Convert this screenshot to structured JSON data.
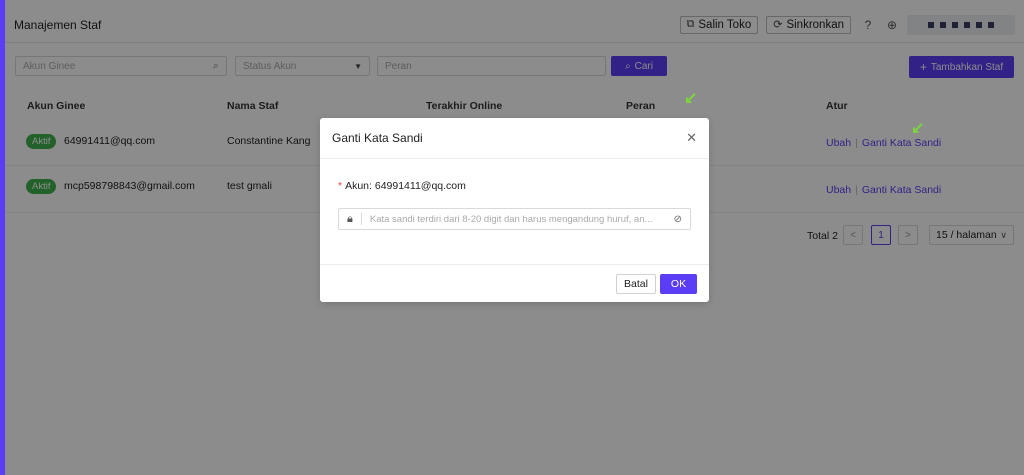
{
  "header": {
    "title": "Manajemen Staf",
    "copy_store_label": "Salin Toko",
    "sync_label": "Sinkronkan"
  },
  "filters": {
    "account_placeholder": "Akun Ginee",
    "status_placeholder": "Status Akun",
    "role_placeholder": "Peran",
    "search_label": "Cari",
    "add_staff_label": "Tambahkan Staf"
  },
  "table": {
    "columns": [
      "Akun Ginee",
      "Nama Staf",
      "Terakhir Online",
      "Peran",
      "Atur"
    ],
    "rows": [
      {
        "status": "Aktif",
        "account": "64991411@qq.com",
        "name": "Constantine Kang",
        "edit": "Ubah",
        "change_password": "Ganti Kata Sandi"
      },
      {
        "status": "Aktif",
        "account": "mcp598798843@gmail.com",
        "name": "test gmali",
        "edit": "Ubah",
        "change_password": "Ganti Kata Sandi"
      }
    ]
  },
  "pagination": {
    "total": "Total 2",
    "prev": "<",
    "current": "1",
    "next": ">",
    "page_size": "15 / halaman"
  },
  "modal": {
    "title": "Ganti Kata Sandi",
    "required_mark": "*",
    "account_label": "Akun: 64991411@qq.com",
    "password_placeholder": "Kata sandi terdiri dari 8-20 digit dan harus mengandung huruf, an...",
    "cancel_label": "Batal",
    "ok_label": "OK"
  },
  "colors": {
    "accent": "#5b3df5",
    "status_active": "#3fb14b",
    "annotation_arrow": "#7cd63a"
  }
}
